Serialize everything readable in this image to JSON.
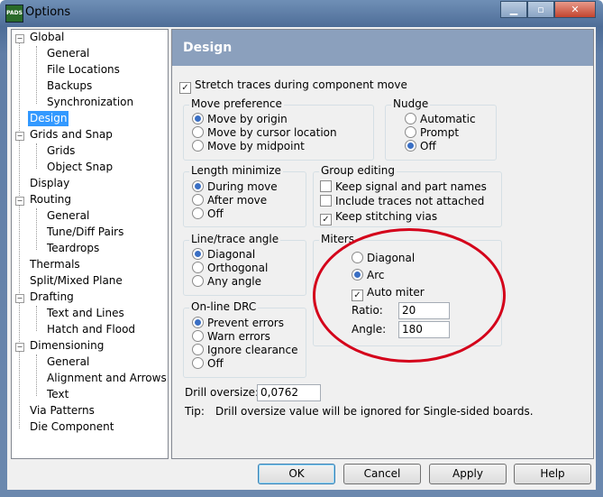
{
  "window": {
    "title": "Options",
    "app_icon_text": "PADS"
  },
  "tree": {
    "items": [
      {
        "label": "Global"
      },
      {
        "label": "General"
      },
      {
        "label": "File Locations"
      },
      {
        "label": "Backups"
      },
      {
        "label": "Synchronization"
      },
      {
        "label": "Design"
      },
      {
        "label": "Grids and Snap"
      },
      {
        "label": "Grids"
      },
      {
        "label": "Object Snap"
      },
      {
        "label": "Display"
      },
      {
        "label": "Routing"
      },
      {
        "label": "General"
      },
      {
        "label": "Tune/Diff Pairs"
      },
      {
        "label": "Teardrops"
      },
      {
        "label": "Thermals"
      },
      {
        "label": "Split/Mixed Plane"
      },
      {
        "label": "Drafting"
      },
      {
        "label": "Text and Lines"
      },
      {
        "label": "Hatch and Flood"
      },
      {
        "label": "Dimensioning"
      },
      {
        "label": "General"
      },
      {
        "label": "Alignment and Arrows"
      },
      {
        "label": "Text"
      },
      {
        "label": "Via Patterns"
      },
      {
        "label": "Die Component"
      }
    ],
    "selected": "Design"
  },
  "panel": {
    "header": "Design",
    "stretch_traces": {
      "label": "Stretch traces during component move",
      "checked": true
    },
    "move_preference": {
      "title": "Move preference",
      "options": [
        "Move by origin",
        "Move by cursor location",
        "Move by midpoint"
      ],
      "selected": 0
    },
    "nudge": {
      "title": "Nudge",
      "options": [
        "Automatic",
        "Prompt",
        "Off"
      ],
      "selected": 2
    },
    "length_minimize": {
      "title": "Length minimize",
      "options": [
        "During move",
        "After move",
        "Off"
      ],
      "selected": 0
    },
    "group_editing": {
      "title": "Group editing",
      "options": [
        "Keep signal and part names",
        "Include traces not attached",
        "Keep stitching vias"
      ],
      "checked": [
        false,
        false,
        true
      ]
    },
    "line_trace_angle": {
      "title": "Line/trace angle",
      "options": [
        "Diagonal",
        "Orthogonal",
        "Any angle"
      ],
      "selected": 0
    },
    "miters": {
      "title": "Miters",
      "options": [
        "Diagonal",
        "Arc"
      ],
      "selected": 1,
      "auto_miter": {
        "label": "Auto miter",
        "checked": true
      },
      "ratio_label": "Ratio:",
      "ratio_value": "20",
      "angle_label": "Angle:",
      "angle_value": "180"
    },
    "online_drc": {
      "title": "On-line DRC",
      "options": [
        "Prevent errors",
        "Warn errors",
        "Ignore clearance",
        "Off"
      ],
      "selected": 0
    },
    "drill_oversize": {
      "label": "Drill oversize:",
      "value": "0,0762"
    },
    "tip": {
      "label": "Tip:",
      "text": "Drill oversize value will be ignored for Single-sided boards."
    }
  },
  "buttons": {
    "ok": "OK",
    "cancel": "Cancel",
    "apply": "Apply",
    "help": "Help"
  },
  "colors": {
    "selection": "#3399ff",
    "header": "#8ba0bd",
    "annotation": "#d4001a"
  }
}
